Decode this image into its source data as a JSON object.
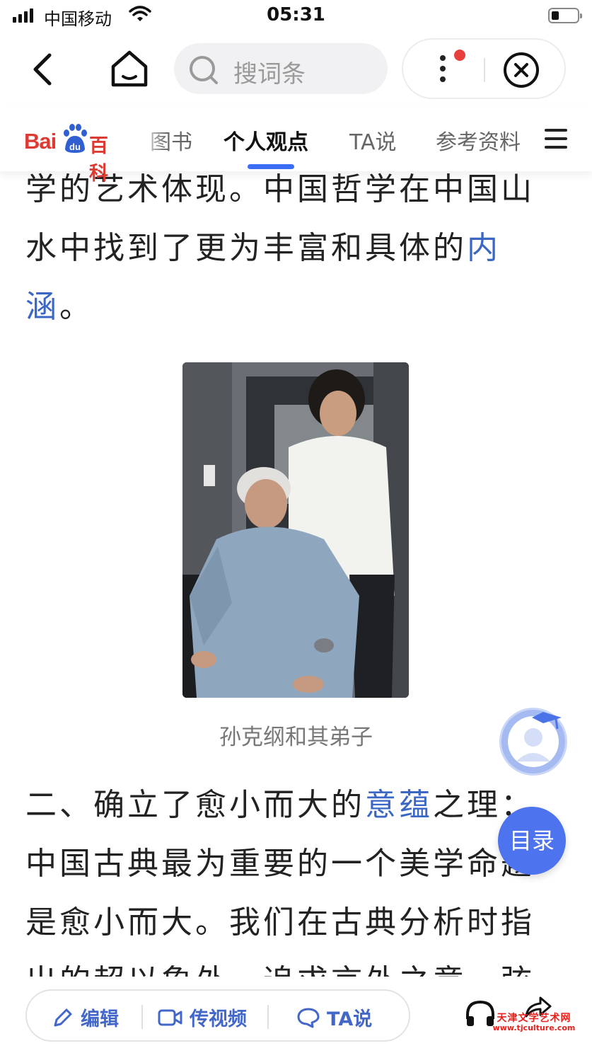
{
  "status_bar": {
    "carrier": "中国移动",
    "time": "05:31"
  },
  "nav": {
    "search_placeholder": "搜词条"
  },
  "logo": {
    "bai": "Bai",
    "du": "du",
    "baike": "百科"
  },
  "tabs": [
    {
      "label": "图书"
    },
    {
      "label": "个人观点"
    },
    {
      "label": "TA说"
    },
    {
      "label": "参考资料"
    }
  ],
  "article": {
    "para1_lines": [
      "学的艺术体现。中国哲学在中国山",
      "水中找到了更为丰富和具体的"
    ],
    "para1_link1": "内",
    "para1_link2": "涵",
    "para1_end": "。",
    "figure_caption": "孙克纲和其弟子",
    "para2_prefix": "二、确立了愈小而大的",
    "para2_link": "意蕴",
    "para2_after": "之理：",
    "para2_lines": [
      "中国古典最为重要的一个美学命题",
      "是愈小而大。我们在古典分析时指",
      "出的超以象外，追求言外之意，弦"
    ]
  },
  "toc_label": "目录",
  "bottom_bar": {
    "edit_label": "编辑",
    "video_label": "传视频",
    "ta_label": "TA说"
  },
  "watermark": {
    "name": "天津文学艺术网",
    "url": "www.tjculture.com"
  },
  "colors": {
    "accent": "#3c6ef5",
    "link": "#3a66c4",
    "brand_red": "#de3a34"
  },
  "icons": [
    "back-icon",
    "home-icon",
    "search-icon",
    "more-icon",
    "close-icon",
    "menu-icon",
    "pencil-icon",
    "video-icon",
    "chat-icon",
    "headphones-icon",
    "share-icon"
  ]
}
